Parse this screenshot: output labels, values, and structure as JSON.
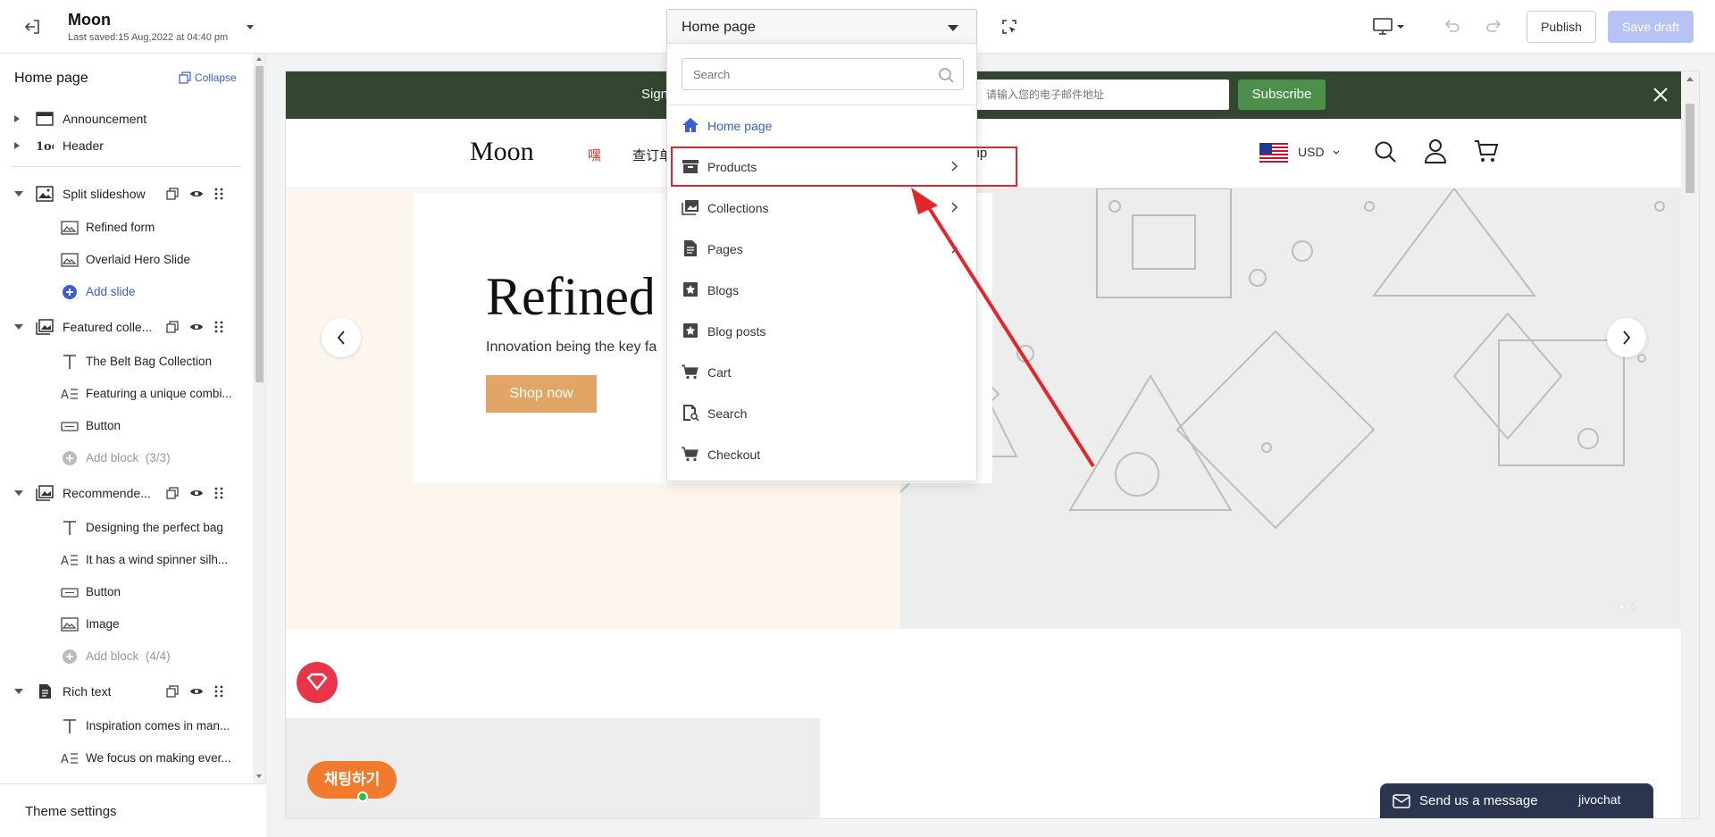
{
  "topbar": {
    "store_title": "Moon",
    "last_saved": "Last saved:15 Aug,2022 at 04:40 pm",
    "page_selector": "Home page",
    "publish_label": "Publish",
    "save_draft_label": "Save draft"
  },
  "sidebar": {
    "heading": "Home page",
    "collapse_label": "Collapse",
    "theme_settings": "Theme settings",
    "sections": [
      {
        "label": "Announcement",
        "icon": "announcement-icon",
        "expanded": false
      },
      {
        "label": "Header",
        "icon": "header-icon",
        "expanded": false
      },
      {
        "label": "Split slideshow",
        "icon": "slideshow-icon",
        "expanded": true,
        "children": [
          "Refined form",
          "Overlaid Hero Slide"
        ],
        "add_label": "Add slide"
      },
      {
        "label": "Featured colle...",
        "icon": "collection-icon",
        "expanded": true,
        "children": [
          "The Belt Bag Collection",
          "Featuring a unique combi...",
          "Button"
        ],
        "add_label": "Add block",
        "add_count": "(3/3)"
      },
      {
        "label": "Recommende...",
        "icon": "collection-icon",
        "expanded": true,
        "children": [
          "Designing the perfect bag",
          "It has a wind spinner silh...",
          "Button",
          "Image"
        ],
        "add_label": "Add block",
        "add_count": "(4/4)"
      },
      {
        "label": "Rich text",
        "icon": "document-icon",
        "expanded": true,
        "children": [
          "Inspiration comes in man...",
          "We focus on making ever..."
        ]
      }
    ]
  },
  "dropdown": {
    "search_placeholder": "Search",
    "items": [
      {
        "label": "Home page",
        "icon": "home-icon",
        "active": true,
        "has_children": false
      },
      {
        "label": "Products",
        "icon": "product-box-icon",
        "active": false,
        "has_children": true
      },
      {
        "label": "Collections",
        "icon": "collections-icon",
        "active": false,
        "has_children": true
      },
      {
        "label": "Pages",
        "icon": "page-icon",
        "active": false,
        "has_children": true
      },
      {
        "label": "Blogs",
        "icon": "blog-icon",
        "active": false,
        "has_children": false
      },
      {
        "label": "Blog posts",
        "icon": "blog-post-icon",
        "active": false,
        "has_children": false
      },
      {
        "label": "Cart",
        "icon": "cart-icon",
        "active": false,
        "has_children": false
      },
      {
        "label": "Search",
        "icon": "search-doc-icon",
        "active": false,
        "has_children": false
      },
      {
        "label": "Checkout",
        "icon": "checkout-cart-icon",
        "active": false,
        "has_children": false
      }
    ]
  },
  "preview": {
    "announcement_text": "Sign",
    "email_placeholder": "请输入您的电子邮件地址",
    "subscribe_label": "Subscribe",
    "logo": "Moon",
    "nav_item_1": "嘿",
    "nav_item_2": "查订单",
    "nav_item_3": "vip",
    "currency": "USD",
    "hero_title": "Refined f",
    "hero_subtitle": "Innovation being the key fa",
    "shop_now_label": "Shop now",
    "chat_button": "채팅하기",
    "jivo_message": "Send us a message",
    "jivo_brand": "jivochat"
  },
  "colors": {
    "accent": "#3a5cd6",
    "announcement_bg": "#33462f",
    "subscribe_bg": "#4c8f4b",
    "shop_now_bg": "#e1a566",
    "highlight_red": "#e4262a",
    "save_draft_bg": "#b7c2f5"
  }
}
